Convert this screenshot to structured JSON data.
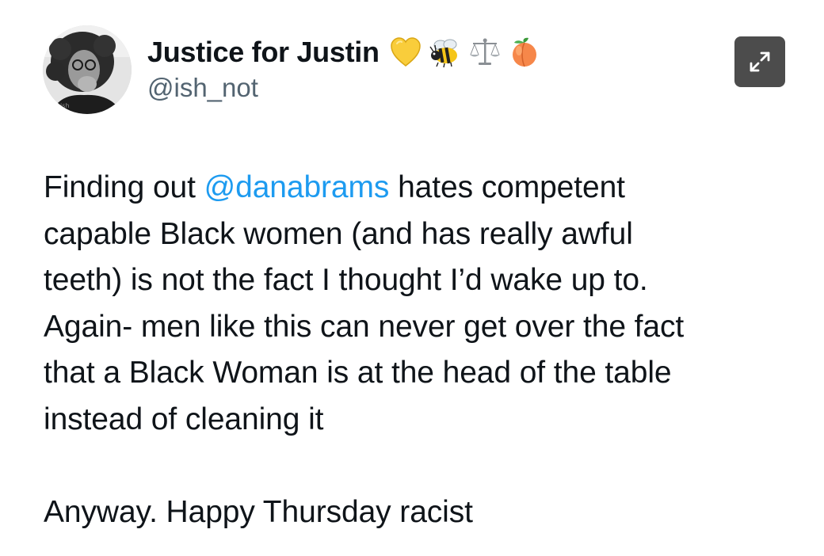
{
  "author": {
    "display_name": "Justice for Justin",
    "handle": "@ish_not",
    "name_emojis": [
      "yellow-heart-icon",
      "bee-icon",
      "balance-scale-icon",
      "peach-icon"
    ]
  },
  "tweet": {
    "line1_before": "Finding out ",
    "mention": "@danabrams",
    "line1_after": " hates competent",
    "line2": "capable Black women (and has really awful",
    "line3": "teeth) is not the fact I thought I’d wake up to.",
    "line4": "Again- men like this can never get over the fact",
    "line5": "that a Black Woman is at the head of the table",
    "line6": "instead of cleaning it",
    "line7": "Anyway. Happy Thursday racist"
  },
  "controls": {
    "expand_icon": "expand-arrows-icon"
  },
  "colors": {
    "mention": "#1d9bf0",
    "handle": "#536471",
    "text": "#0f1419",
    "expand_bg": "#4c4c4c"
  }
}
